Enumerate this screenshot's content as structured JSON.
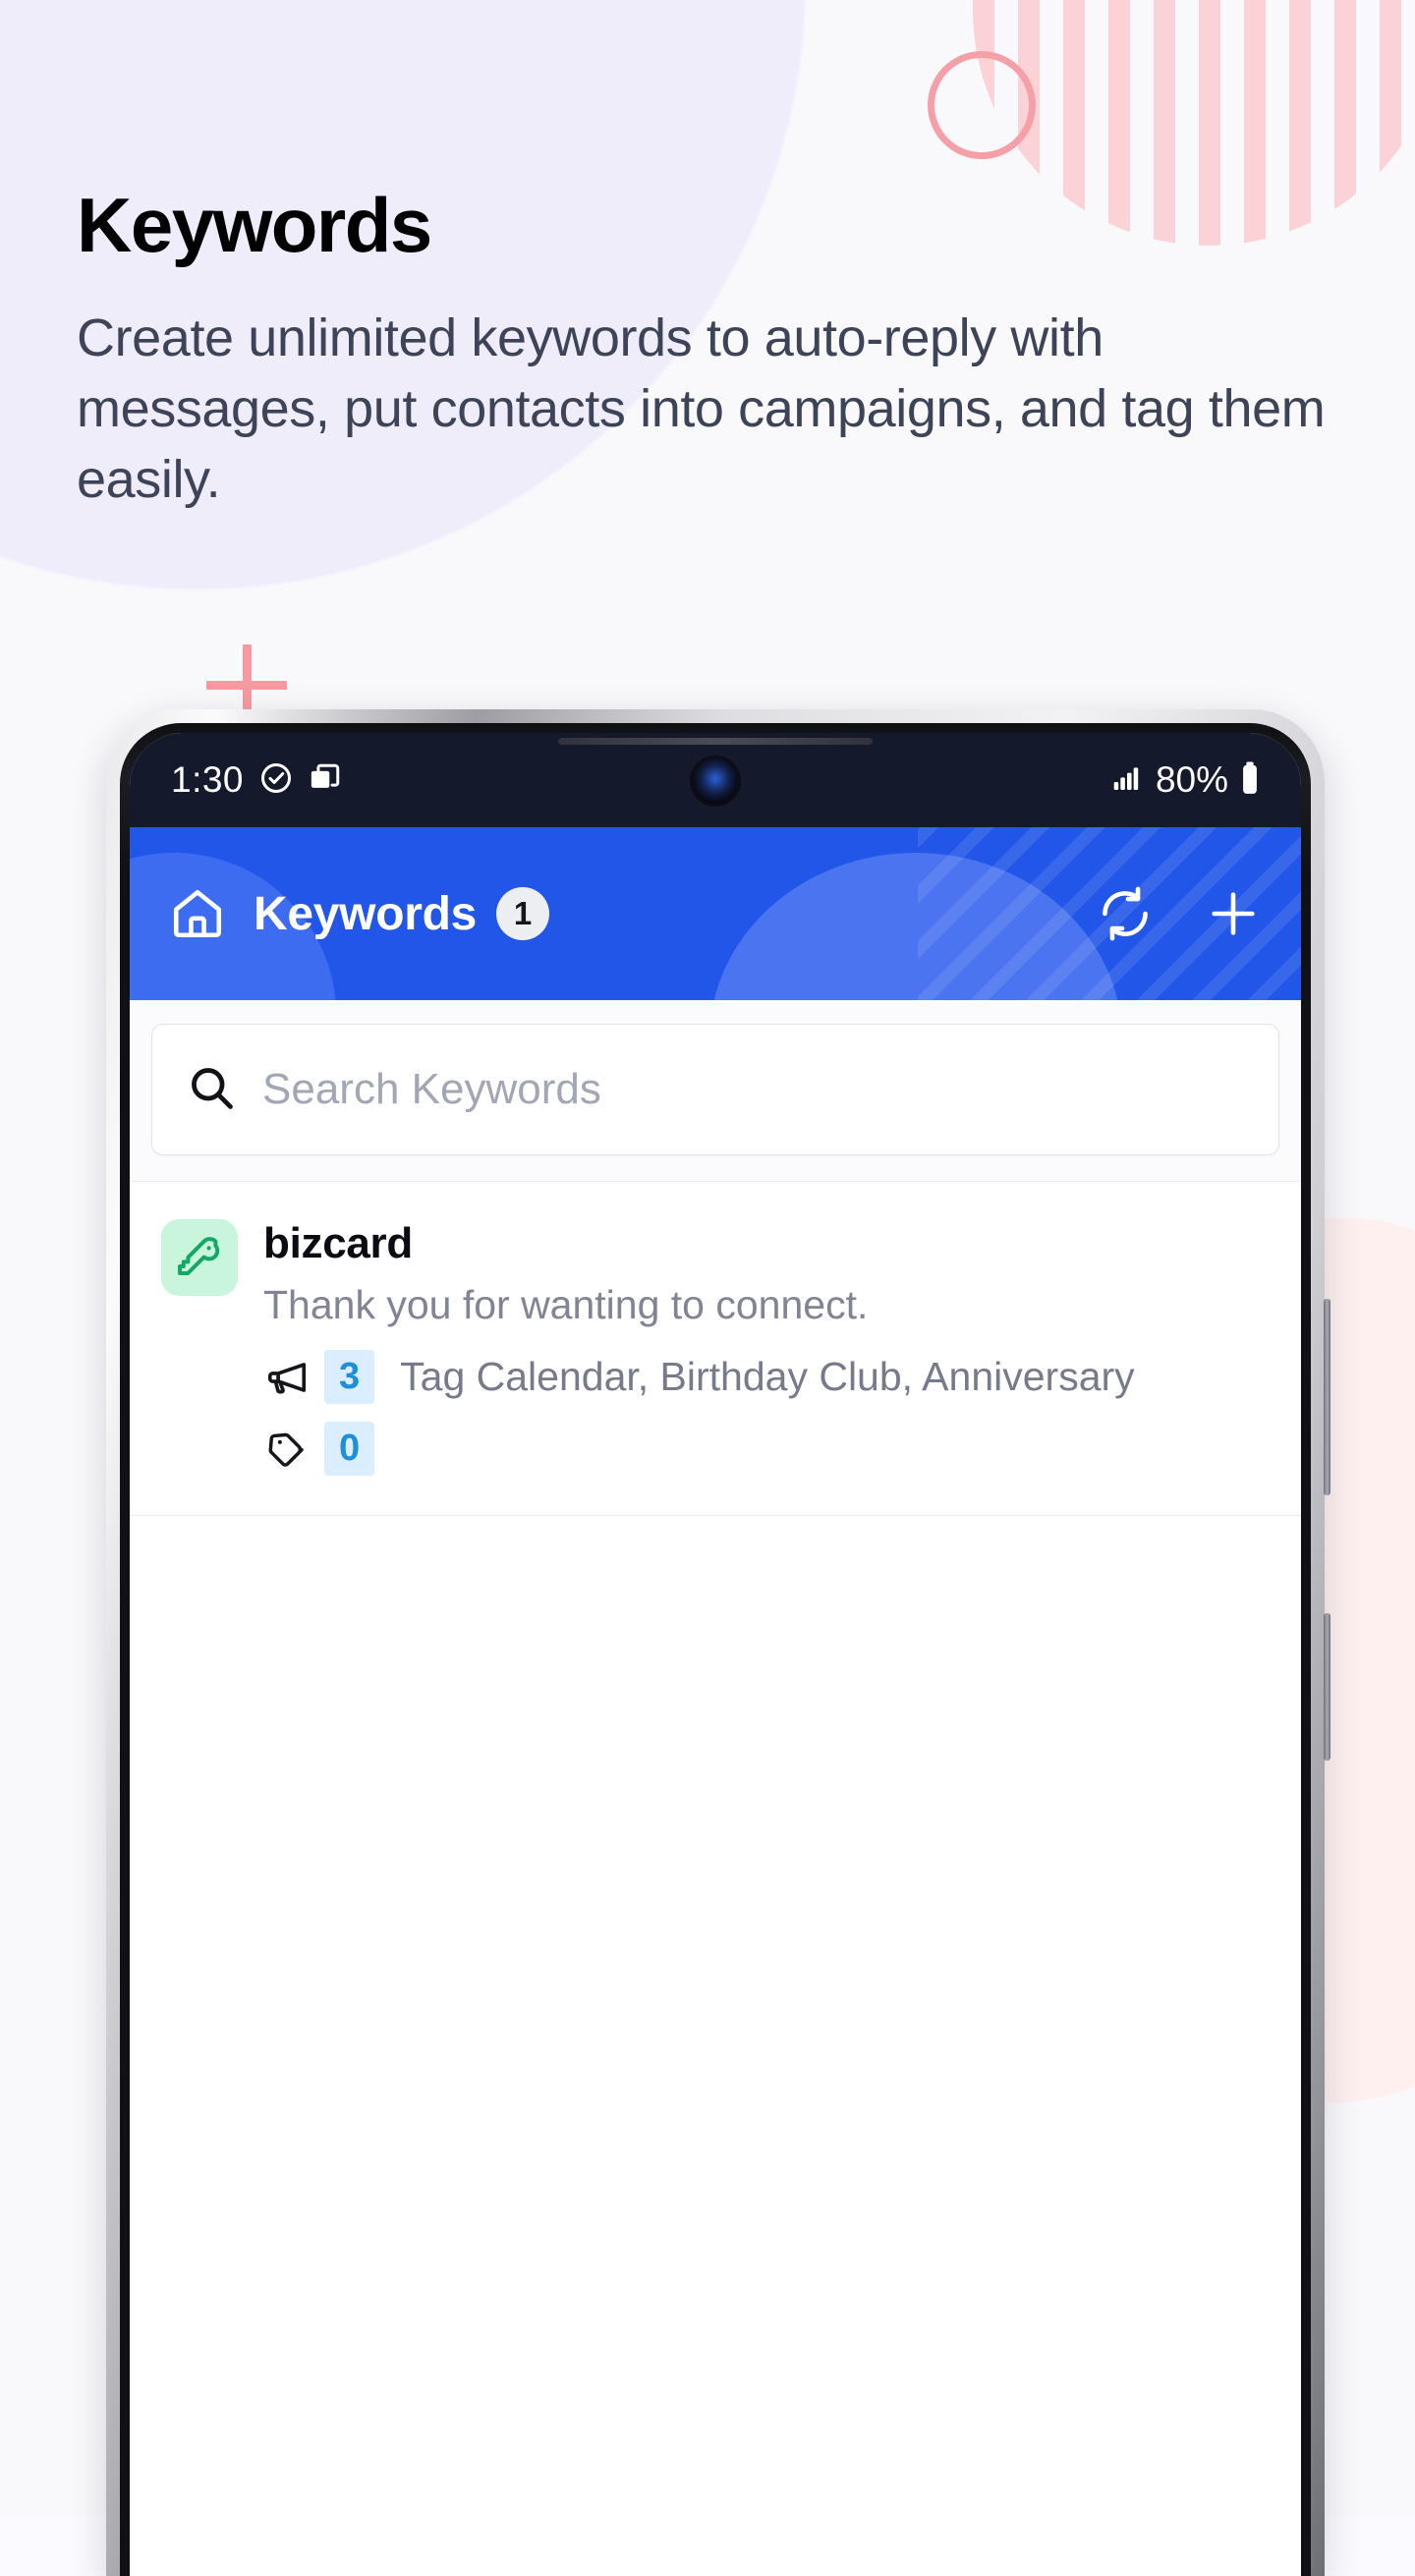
{
  "promo": {
    "headline": "Keywords",
    "subheadline": "Create unlimited keywords to auto-reply with messages, put contacts into campaigns, and tag them easily."
  },
  "phone": {
    "status_bar": {
      "time": "1:30",
      "check_icon": "check-circle-icon",
      "apps_icon": "copy-windows-icon",
      "signal_icon": "signal-bars-icon",
      "battery_percent": "80%",
      "battery_icon": "battery-icon"
    },
    "app_bar": {
      "home_icon": "home-icon",
      "title": "Keywords",
      "count_badge": "1",
      "sync_icon": "sync-refresh-icon",
      "add_icon": "plus-icon"
    },
    "search": {
      "icon": "search-icon",
      "placeholder": "Search Keywords"
    },
    "keywords": [
      {
        "icon": "key-icon",
        "name": "bizcard",
        "description": "Thank you for wanting to connect.",
        "campaigns": {
          "icon": "megaphone-icon",
          "count": "3",
          "names": "Tag Calendar, Birthday Club, Anniversary"
        },
        "tags": {
          "icon": "tag-icon",
          "count": "0",
          "names": ""
        }
      }
    ]
  },
  "colors": {
    "brand_blue": "#2156e8",
    "accent_pink": "#f5a0a8",
    "count_blue": "#1e8fd8",
    "count_bg": "#daeeff",
    "key_chip_bg": "#c9f5dd",
    "key_icon": "#16a86a",
    "status_bar_bg": "#141a2c",
    "page_bg": "#f9f9fc",
    "lavender_blob": "#f0edfb"
  }
}
